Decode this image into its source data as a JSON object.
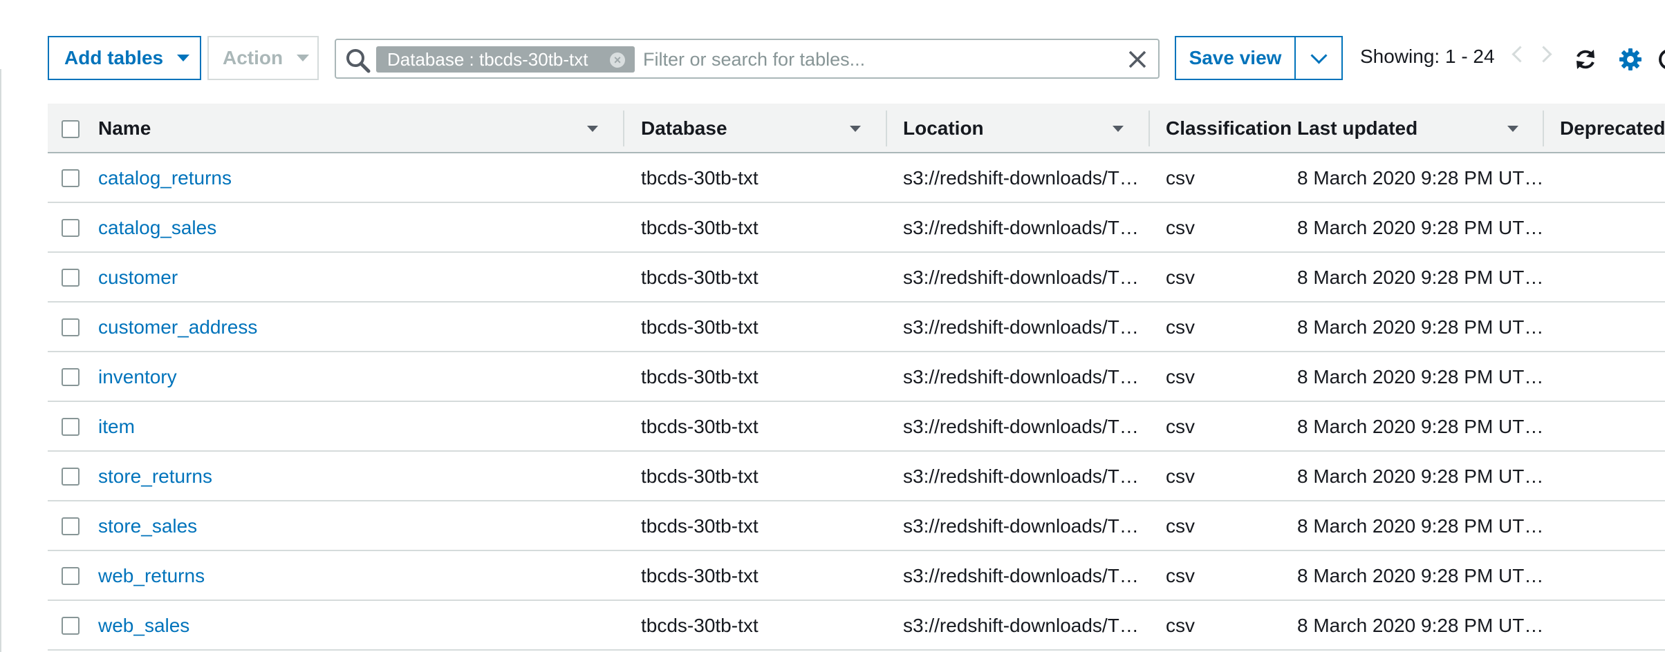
{
  "toolbar": {
    "add_tables_label": "Add tables",
    "action_label": "Action",
    "filter_chip_label": "Database : tbcds-30tb-txt",
    "search_placeholder": "Filter or search for tables...",
    "save_view_label": "Save view",
    "showing_text": "Showing: 1 - 24"
  },
  "table": {
    "columns": [
      "Name",
      "Database",
      "Location",
      "Classification",
      "Last updated",
      "Deprecated"
    ],
    "rows": [
      {
        "name": "catalog_returns",
        "database": "tbcds-30tb-txt",
        "location": "s3://redshift-downloads/T…",
        "classification": "csv",
        "last_updated": "8 March 2020 9:28 PM UT…"
      },
      {
        "name": "catalog_sales",
        "database": "tbcds-30tb-txt",
        "location": "s3://redshift-downloads/T…",
        "classification": "csv",
        "last_updated": "8 March 2020 9:28 PM UT…"
      },
      {
        "name": "customer",
        "database": "tbcds-30tb-txt",
        "location": "s3://redshift-downloads/T…",
        "classification": "csv",
        "last_updated": "8 March 2020 9:28 PM UT…"
      },
      {
        "name": "customer_address",
        "database": "tbcds-30tb-txt",
        "location": "s3://redshift-downloads/T…",
        "classification": "csv",
        "last_updated": "8 March 2020 9:28 PM UT…"
      },
      {
        "name": "inventory",
        "database": "tbcds-30tb-txt",
        "location": "s3://redshift-downloads/T…",
        "classification": "csv",
        "last_updated": "8 March 2020 9:28 PM UT…"
      },
      {
        "name": "item",
        "database": "tbcds-30tb-txt",
        "location": "s3://redshift-downloads/T…",
        "classification": "csv",
        "last_updated": "8 March 2020 9:28 PM UT…"
      },
      {
        "name": "store_returns",
        "database": "tbcds-30tb-txt",
        "location": "s3://redshift-downloads/T…",
        "classification": "csv",
        "last_updated": "8 March 2020 9:28 PM UT…"
      },
      {
        "name": "store_sales",
        "database": "tbcds-30tb-txt",
        "location": "s3://redshift-downloads/T…",
        "classification": "csv",
        "last_updated": "8 March 2020 9:28 PM UT…"
      },
      {
        "name": "web_returns",
        "database": "tbcds-30tb-txt",
        "location": "s3://redshift-downloads/T…",
        "classification": "csv",
        "last_updated": "8 March 2020 9:28 PM UT…"
      },
      {
        "name": "web_sales",
        "database": "tbcds-30tb-txt",
        "location": "s3://redshift-downloads/T…",
        "classification": "csv",
        "last_updated": "8 March 2020 9:28 PM UT…"
      }
    ]
  },
  "colors": {
    "link": "#0073bb",
    "header_bg": "#f2f3f3",
    "chip_bg": "#a0a9ab",
    "border": "#d5dbdb"
  },
  "icons": [
    "search-icon",
    "clear-icon",
    "chevron-down-icon",
    "chevron-left-icon",
    "chevron-right-icon",
    "refresh-icon",
    "gear-icon"
  ]
}
